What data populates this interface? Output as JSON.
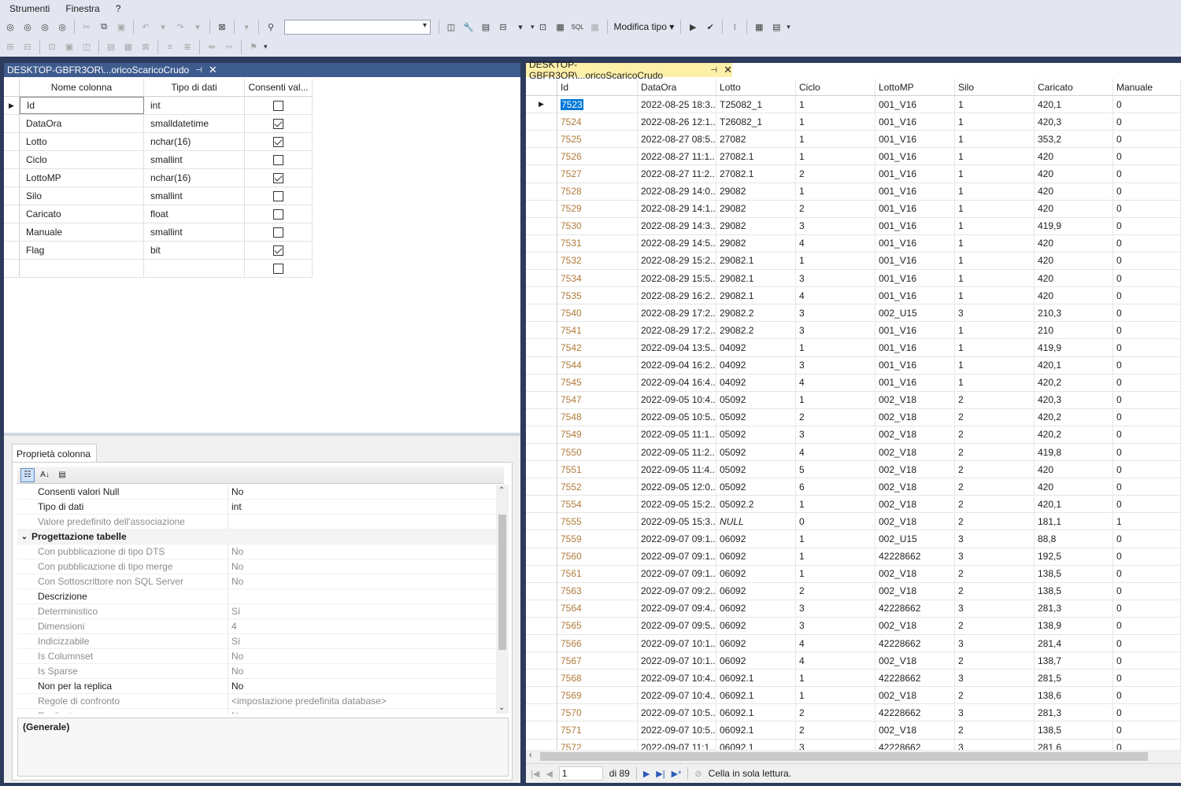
{
  "menu": [
    "Strumenti",
    "Finestra",
    "?"
  ],
  "toolbar": {
    "modifica_tipo": "Modifica tipo",
    "combo_value": ""
  },
  "left_tab": {
    "title": "DESKTOP-GBFR3OR\\...oricoScaricoCrudo"
  },
  "right_tab": {
    "title": "DESKTOP-GBFR3OR\\...oricoScaricoCrudo"
  },
  "designer": {
    "headers": [
      "Nome colonna",
      "Tipo di dati",
      "Consenti val..."
    ],
    "rows": [
      {
        "name": "Id",
        "type": "int",
        "null": false
      },
      {
        "name": "DataOra",
        "type": "smalldatetime",
        "null": true
      },
      {
        "name": "Lotto",
        "type": "nchar(16)",
        "null": true
      },
      {
        "name": "Ciclo",
        "type": "smallint",
        "null": false
      },
      {
        "name": "LottoMP",
        "type": "nchar(16)",
        "null": true
      },
      {
        "name": "Silo",
        "type": "smallint",
        "null": false
      },
      {
        "name": "Caricato",
        "type": "float",
        "null": false
      },
      {
        "name": "Manuale",
        "type": "smallint",
        "null": false
      },
      {
        "name": "Flag",
        "type": "bit",
        "null": true
      },
      {
        "name": "",
        "type": "",
        "null": false
      }
    ]
  },
  "properties": {
    "tab": "Proprietà colonna",
    "rows": [
      {
        "n": "Consenti valori Null",
        "v": "No",
        "g": false
      },
      {
        "n": "Tipo di dati",
        "v": "int",
        "g": false
      },
      {
        "n": "Valore predefinito dell'associazione",
        "v": "",
        "g": true
      },
      {
        "n": "Progettazione tabelle",
        "v": "",
        "g": false,
        "cat": true
      },
      {
        "n": "Con pubblicazione di tipo DTS",
        "v": "No",
        "g": true
      },
      {
        "n": "Con pubblicazione di tipo merge",
        "v": "No",
        "g": true
      },
      {
        "n": "Con Sottoscrittore non SQL Server",
        "v": "No",
        "g": true
      },
      {
        "n": "Descrizione",
        "v": "",
        "g": false
      },
      {
        "n": "Deterministico",
        "v": "Sì",
        "g": true
      },
      {
        "n": "Dimensioni",
        "v": "4",
        "g": true
      },
      {
        "n": "Indicizzabile",
        "v": "Sì",
        "g": true
      },
      {
        "n": "Is Columnset",
        "v": "No",
        "g": true
      },
      {
        "n": "Is Sparse",
        "v": "No",
        "g": true
      },
      {
        "n": "Non per la replica",
        "v": "No",
        "g": false
      },
      {
        "n": "Regole di confronto",
        "v": "<impostazione predefinita database>",
        "g": true
      },
      {
        "n": "Replicato",
        "v": "No",
        "g": true
      }
    ],
    "desc": "(Generale)"
  },
  "results": {
    "headers": [
      "Id",
      "DataOra",
      "Lotto",
      "Ciclo",
      "LottoMP",
      "Silo",
      "Caricato",
      "Manuale"
    ],
    "rows": [
      [
        "7523",
        "2022-08-25 18:3...",
        "T25082_1",
        "1",
        "001_V16",
        "1",
        "420,1",
        "0"
      ],
      [
        "7524",
        "2022-08-26 12:1...",
        "T26082_1",
        "1",
        "001_V16",
        "1",
        "420,3",
        "0"
      ],
      [
        "7525",
        "2022-08-27 08:5...",
        "27082",
        "1",
        "001_V16",
        "1",
        "353,2",
        "0"
      ],
      [
        "7526",
        "2022-08-27 11:1...",
        "27082.1",
        "1",
        "001_V16",
        "1",
        "420",
        "0"
      ],
      [
        "7527",
        "2022-08-27 11:2...",
        "27082.1",
        "2",
        "001_V16",
        "1",
        "420",
        "0"
      ],
      [
        "7528",
        "2022-08-29 14:0...",
        "29082",
        "1",
        "001_V16",
        "1",
        "420",
        "0"
      ],
      [
        "7529",
        "2022-08-29 14:1...",
        "29082",
        "2",
        "001_V16",
        "1",
        "420",
        "0"
      ],
      [
        "7530",
        "2022-08-29 14:3...",
        "29082",
        "3",
        "001_V16",
        "1",
        "419,9",
        "0"
      ],
      [
        "7531",
        "2022-08-29 14:5...",
        "29082",
        "4",
        "001_V16",
        "1",
        "420",
        "0"
      ],
      [
        "7532",
        "2022-08-29 15:2...",
        "29082.1",
        "1",
        "001_V16",
        "1",
        "420",
        "0"
      ],
      [
        "7534",
        "2022-08-29 15:5...",
        "29082.1",
        "3",
        "001_V16",
        "1",
        "420",
        "0"
      ],
      [
        "7535",
        "2022-08-29 16:2...",
        "29082.1",
        "4",
        "001_V16",
        "1",
        "420",
        "0"
      ],
      [
        "7540",
        "2022-08-29 17:2...",
        "29082.2",
        "3",
        "002_U15",
        "3",
        "210,3",
        "0"
      ],
      [
        "7541",
        "2022-08-29 17:2...",
        "29082.2",
        "3",
        "001_V16",
        "1",
        "210",
        "0"
      ],
      [
        "7542",
        "2022-09-04 13:5...",
        "04092",
        "1",
        "001_V16",
        "1",
        "419,9",
        "0"
      ],
      [
        "7544",
        "2022-09-04 16:2...",
        "04092",
        "3",
        "001_V16",
        "1",
        "420,1",
        "0"
      ],
      [
        "7545",
        "2022-09-04 16:4...",
        "04092",
        "4",
        "001_V16",
        "1",
        "420,2",
        "0"
      ],
      [
        "7547",
        "2022-09-05 10:4...",
        "05092",
        "1",
        "002_V18",
        "2",
        "420,3",
        "0"
      ],
      [
        "7548",
        "2022-09-05 10:5...",
        "05092",
        "2",
        "002_V18",
        "2",
        "420,2",
        "0"
      ],
      [
        "7549",
        "2022-09-05 11:1...",
        "05092",
        "3",
        "002_V18",
        "2",
        "420,2",
        "0"
      ],
      [
        "7550",
        "2022-09-05 11:2...",
        "05092",
        "4",
        "002_V18",
        "2",
        "419,8",
        "0"
      ],
      [
        "7551",
        "2022-09-05 11:4...",
        "05092",
        "5",
        "002_V18",
        "2",
        "420",
        "0"
      ],
      [
        "7552",
        "2022-09-05 12:0...",
        "05092",
        "6",
        "002_V18",
        "2",
        "420",
        "0"
      ],
      [
        "7554",
        "2022-09-05 15:2...",
        "05092.2",
        "1",
        "002_V18",
        "2",
        "420,1",
        "0"
      ],
      [
        "7555",
        "2022-09-05 15:3...",
        "NULL",
        "0",
        "002_V18",
        "2",
        "181,1",
        "1"
      ],
      [
        "7559",
        "2022-09-07 09:1...",
        "06092",
        "1",
        "002_U15",
        "3",
        "88,8",
        "0"
      ],
      [
        "7560",
        "2022-09-07 09:1...",
        "06092",
        "1",
        "42228662",
        "3",
        "192,5",
        "0"
      ],
      [
        "7561",
        "2022-09-07 09:1...",
        "06092",
        "1",
        "002_V18",
        "2",
        "138,5",
        "0"
      ],
      [
        "7563",
        "2022-09-07 09:2...",
        "06092",
        "2",
        "002_V18",
        "2",
        "138,5",
        "0"
      ],
      [
        "7564",
        "2022-09-07 09:4...",
        "06092",
        "3",
        "42228662",
        "3",
        "281,3",
        "0"
      ],
      [
        "7565",
        "2022-09-07 09:5...",
        "06092",
        "3",
        "002_V18",
        "2",
        "138,9",
        "0"
      ],
      [
        "7566",
        "2022-09-07 10:1...",
        "06092",
        "4",
        "42228662",
        "3",
        "281,4",
        "0"
      ],
      [
        "7567",
        "2022-09-07 10:1...",
        "06092",
        "4",
        "002_V18",
        "2",
        "138,7",
        "0"
      ],
      [
        "7568",
        "2022-09-07 10:4...",
        "06092.1",
        "1",
        "42228662",
        "3",
        "281,5",
        "0"
      ],
      [
        "7569",
        "2022-09-07 10:4...",
        "06092.1",
        "1",
        "002_V18",
        "2",
        "138,6",
        "0"
      ],
      [
        "7570",
        "2022-09-07 10:5...",
        "06092.1",
        "2",
        "42228662",
        "3",
        "281,3",
        "0"
      ],
      [
        "7571",
        "2022-09-07 10:5...",
        "06092.1",
        "2",
        "002_V18",
        "2",
        "138,5",
        "0"
      ],
      [
        "7572",
        "2022-09-07 11:1...",
        "06092.1",
        "3",
        "42228662",
        "3",
        "281,6",
        "0"
      ]
    ]
  },
  "nav": {
    "page": "1",
    "of": "di 89",
    "status": "Cella in sola lettura."
  }
}
